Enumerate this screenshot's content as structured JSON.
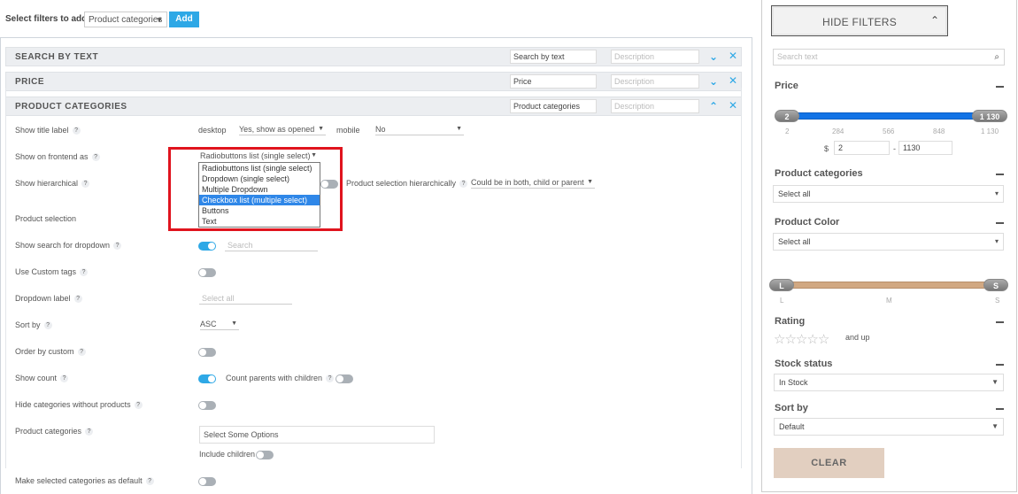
{
  "topbar": {
    "label": "Select filters to add",
    "select_value": "Product categories",
    "add_label": "Add"
  },
  "filters": [
    {
      "title": "SEARCH BY TEXT",
      "name_value": "Search by text",
      "desc_placeholder": "Description"
    },
    {
      "title": "PRICE",
      "name_value": "Price",
      "desc_placeholder": "Description"
    },
    {
      "title": "PRODUCT CATEGORIES",
      "name_value": "Product categories",
      "desc_placeholder": "Description"
    }
  ],
  "settings": {
    "show_title_label": {
      "label": "Show title label",
      "desktop_label": "desktop",
      "desktop_value": "Yes, show as opened",
      "mobile_label": "mobile",
      "mobile_value": "No"
    },
    "show_on_frontend": {
      "label": "Show on frontend as",
      "value": "Radiobuttons list (single select)"
    },
    "show_hierarchical": {
      "label": "Show hierarchical",
      "sub_label": "Product selection hierarchically",
      "sub_value": "Could be in both, child or parent"
    },
    "product_selection": {
      "label": "Product selection"
    },
    "show_search": {
      "label": "Show search for dropdown",
      "placeholder": "Search"
    },
    "custom_tags": {
      "label": "Use Custom tags"
    },
    "dropdown_label": {
      "label": "Dropdown label",
      "placeholder": "Select all"
    },
    "sort_by": {
      "label": "Sort by",
      "value": "ASC"
    },
    "order_custom": {
      "label": "Order by custom"
    },
    "show_count": {
      "label": "Show count",
      "sub_label": "Count parents with children"
    },
    "hide_empty": {
      "label": "Hide categories without products"
    },
    "product_categories": {
      "label": "Product categories",
      "placeholder": "Select Some Options",
      "include_children": "Include children"
    },
    "make_default": {
      "label": "Make selected categories as default"
    }
  },
  "dropdown_options": [
    "Radiobuttons list (single select)",
    "Dropdown (single select)",
    "Multiple Dropdown",
    "Checkbox list (multiple select)",
    "Buttons",
    "Text"
  ],
  "sidebar": {
    "hide_filters": "HIDE FILTERS",
    "search_placeholder": "Search text",
    "price": {
      "title": "Price",
      "min_knob": "2",
      "max_knob": "1 130",
      "ticks": [
        "2",
        "284",
        "566",
        "848",
        "1 130"
      ],
      "currency": "$",
      "min_value": "2",
      "sep": "-",
      "max_value": "1130"
    },
    "categories": {
      "title": "Product categories",
      "value": "Select all"
    },
    "color": {
      "title": "Product Color",
      "value": "Select all"
    },
    "size": {
      "left_knob": "L",
      "right_knob": "S",
      "ticks": [
        "L",
        "M",
        "S"
      ]
    },
    "rating": {
      "title": "Rating",
      "and_up": "and up",
      "stars": 5
    },
    "stock": {
      "title": "Stock status",
      "value": "In Stock"
    },
    "sort": {
      "title": "Sort by",
      "value": "Default"
    },
    "clear": "CLEAR"
  },
  "colors": {
    "accent": "#2ea8e6",
    "highlight": "#2f87e8",
    "red_box": "#e0141e",
    "price_bar": "#1273e6",
    "size_bar": "#d1a882",
    "clear_bg": "#e2cfc0"
  }
}
